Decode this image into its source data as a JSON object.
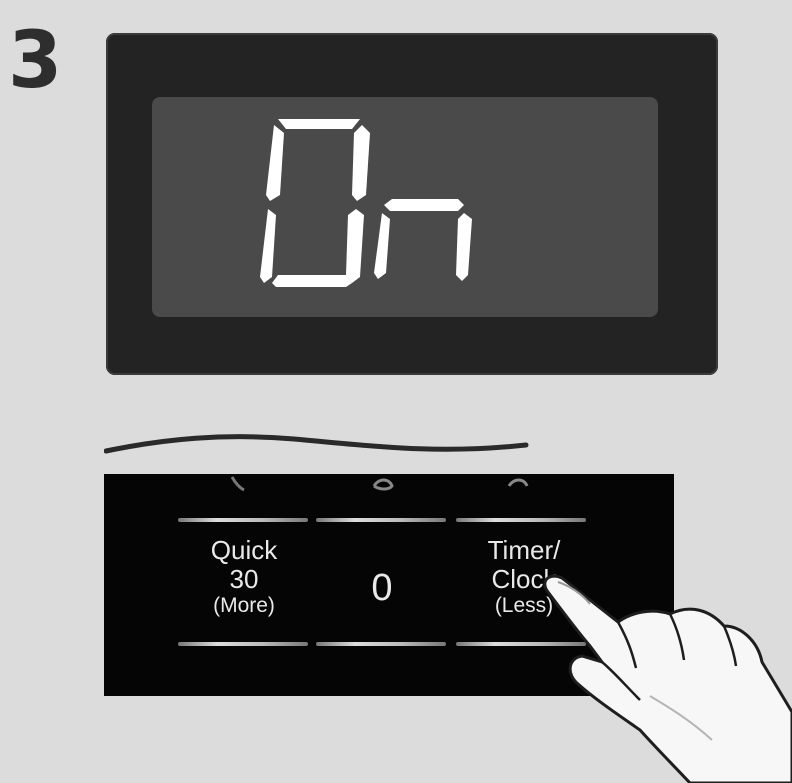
{
  "step": {
    "number": "3"
  },
  "display": {
    "text": "On"
  },
  "keypad": {
    "quick30": {
      "line1": "Quick",
      "line2": "30",
      "line3": "(More)"
    },
    "zero": {
      "label": "0"
    },
    "timer_clock": {
      "line1": "Timer/",
      "line2": "Clock",
      "line3": "(Less)"
    }
  },
  "icons": {
    "pointing_hand": "pointing-hand-icon"
  },
  "colors": {
    "background": "#dcdcdc",
    "bezel": "#232323",
    "lcd": "#4a4a4a",
    "panel": "#050505",
    "segment": "#ffffff"
  }
}
